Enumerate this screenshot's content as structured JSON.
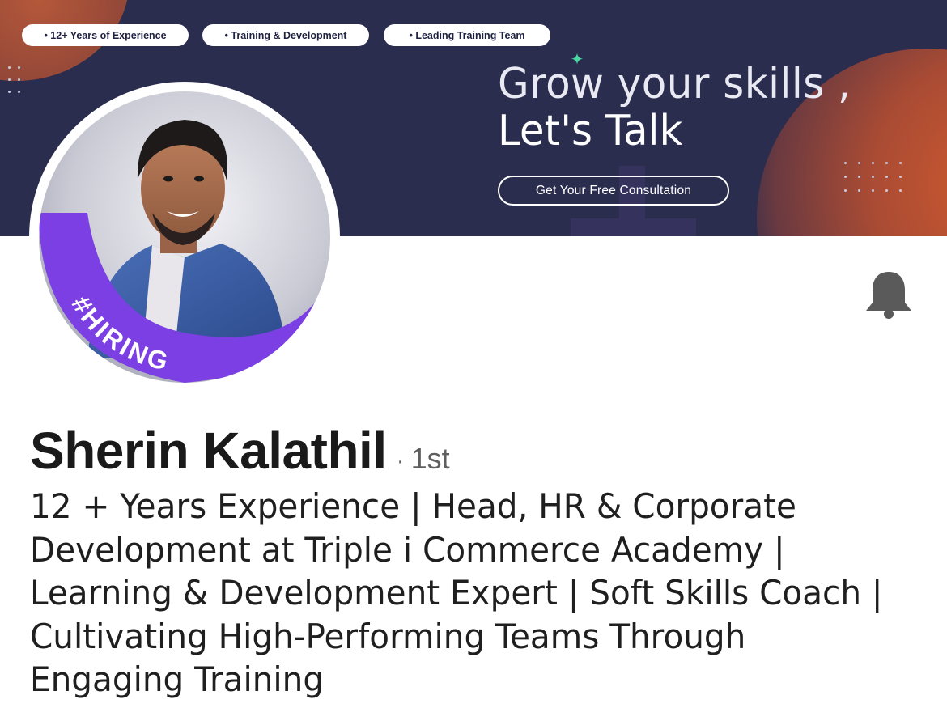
{
  "banner": {
    "pills": [
      "• 12+ Years of Experience",
      "• Training & Development",
      "• Leading Training Team"
    ],
    "headline_line1": "Grow your skills ,",
    "headline_line2": "Let's Talk",
    "cta_label": "Get Your Free Consultation",
    "colors": {
      "background": "#2b2d4f",
      "accent_orange": "#cf5a2e",
      "sparkle": "#4bd6a3"
    }
  },
  "avatar": {
    "frame_text": "#HIRING",
    "frame_color": "#7b3fe4"
  },
  "notification": {
    "icon": "bell-icon"
  },
  "profile": {
    "name": "Sherin Kalathil",
    "separator": "·",
    "connection_degree": "1st",
    "headline": "12 + Years Experience | Head, HR & Corporate Development at Triple i Commerce Academy | Learning & Development Expert | Soft Skills Coach | Cultivating High-Performing Teams Through Engaging Training"
  }
}
